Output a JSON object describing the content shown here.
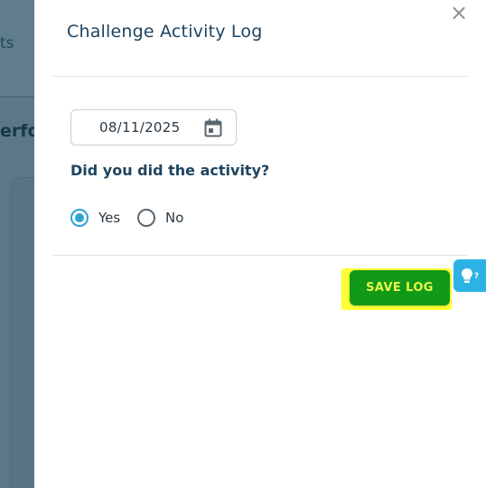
{
  "background": {
    "tab_text": "ts",
    "heading_text": "erfor"
  },
  "dialog": {
    "title": "Challenge Activity Log",
    "close_symbol": "×",
    "date_value": "08/11/2025",
    "question": "Did you did the activity?",
    "options": [
      {
        "label": "Yes",
        "checked": true
      },
      {
        "label": "No",
        "checked": false
      }
    ],
    "save_label": "SAVE LOG"
  },
  "help_tab": {
    "icon": "lightbulb-question-icon",
    "symbol": "?"
  },
  "colors": {
    "accent": "#2ea3d6",
    "save_button": "#109a18",
    "save_text": "#e9f54a",
    "highlight": "#ffff33",
    "title_text": "#1e4460"
  }
}
